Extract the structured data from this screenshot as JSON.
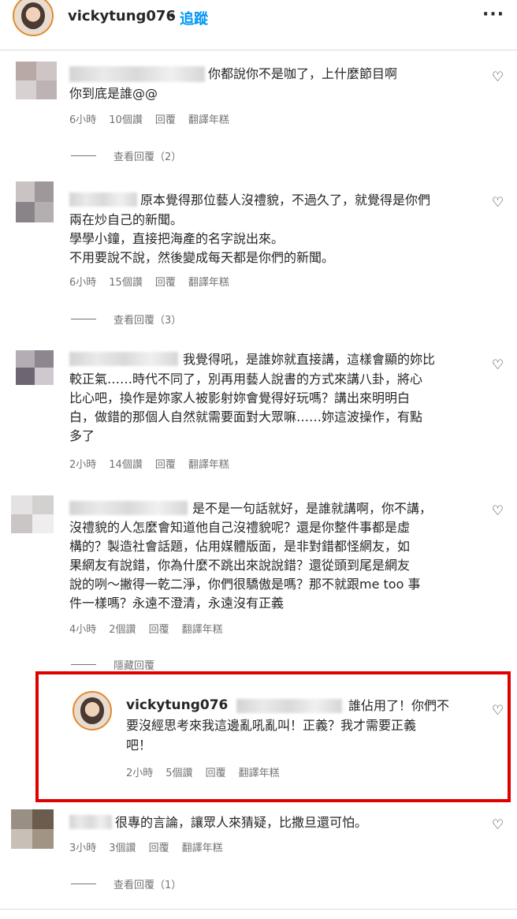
{
  "header": {
    "username": "vickytung076",
    "separator": "•",
    "follow_label": "追蹤",
    "more_icon": "more-horizontal-icon"
  },
  "comments": [
    {
      "lines": [
        "你都說你不是咖了，上什麼節目啊",
        "你到底是誰@@"
      ],
      "time": "6小時",
      "likes": "10個讚",
      "reply": "回覆",
      "translate": "翻譯年糕",
      "view_replies": "查看回覆（2）"
    },
    {
      "lines": [
        "原本覺得那位藝人沒禮貌，不過久了，就覺得是你們",
        "兩在炒自己的新聞。",
        "學學小鐘，直接把海產的名字說出來。",
        "不用要說不說，然後變成每天都是你們的新聞。"
      ],
      "time": "6小時",
      "likes": "15個讚",
      "reply": "回覆",
      "translate": "翻譯年糕",
      "view_replies": "查看回覆（3）"
    },
    {
      "lines": [
        "我覺得吼，是誰妳就直接講，這樣會顯的妳比",
        "較正氣……時代不同了，別再用藝人說書的方式來講八卦，將心",
        "比心吧，換作是妳家人被影射妳會覺得好玩嗎？講出來明明白",
        "白，做錯的那個人自然就需要面對大眾嘛……妳這波操作，有點",
        "多了"
      ],
      "time": "2小時",
      "likes": "14個讚",
      "reply": "回覆",
      "translate": "翻譯年糕"
    },
    {
      "lines": [
        "是不是一句話就好，是誰就講啊，你不講，",
        "沒禮貌的人怎麼會知道他自己沒禮貌呢？還是你整件事都是虛",
        "構的？製造社會話題，佔用媒體版面，是非對錯都怪網友，如",
        "果網友有說錯，你為什麼不跳出來說說錯？還從頭到尾是網友",
        "說的咧～撇得一乾二淨，你們很驕傲是嗎？那不就跟me too 事",
        "件一樣嗎？永遠不澄清，永遠沒有正義"
      ],
      "time": "4小時",
      "likes": "2個讚",
      "reply": "回覆",
      "translate": "翻譯年糕",
      "hide_replies": "隱藏回覆"
    },
    {
      "lines": [
        "很專的言論，讓眾人來猜疑，比撒旦還可怕。"
      ],
      "time": "3小時",
      "likes": "3個讚",
      "reply": "回覆",
      "translate": "翻譯年糕",
      "view_replies": "查看回覆（1）"
    }
  ],
  "owner_reply": {
    "username": "vickytung076",
    "lines": [
      "誰佔用了！你們不",
      "要沒經思考來我這邊亂吼亂叫！正義？我才需要正義",
      "吧！"
    ],
    "time": "2小時",
    "likes": "5個讚",
    "reply": "回覆",
    "translate": "翻譯年糕",
    "highlight_color": "#e00000"
  },
  "icons": {
    "like": "heart-outline-icon"
  },
  "colors": {
    "follow": "#0095f6",
    "meta": "#737373",
    "text": "#262626"
  }
}
